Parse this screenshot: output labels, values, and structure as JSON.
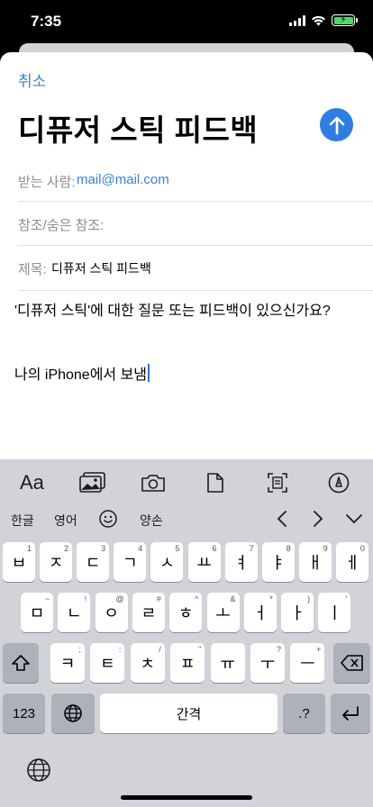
{
  "status": {
    "time": "7:35"
  },
  "compose": {
    "cancel_label": "취소",
    "title": "디퓨저 스틱 피드백",
    "to_label": "받는 사람:",
    "to_value": "mail@mail.com",
    "cc_label": "참조/숨은 참조:",
    "subject_label": "제목:",
    "subject_value": "디퓨저 스틱 피드백",
    "body": "'디퓨저 스틱'에 대한 질문 또는 피드백이 있으신가요?",
    "signature": "나의 iPhone에서 보냄"
  },
  "keyboard": {
    "toolbar": {
      "format_label": "Aa"
    },
    "suggestions": {
      "lang_korean": "한글",
      "lang_english": "영어",
      "suggestion": "양손"
    },
    "row1": [
      {
        "k": "ㅂ",
        "h": "1"
      },
      {
        "k": "ㅈ",
        "h": "2"
      },
      {
        "k": "ㄷ",
        "h": "3"
      },
      {
        "k": "ㄱ",
        "h": "4"
      },
      {
        "k": "ㅅ",
        "h": "5"
      },
      {
        "k": "ㅛ",
        "h": "6"
      },
      {
        "k": "ㅕ",
        "h": "7"
      },
      {
        "k": "ㅑ",
        "h": "8"
      },
      {
        "k": "ㅐ",
        "h": "9"
      },
      {
        "k": "ㅔ",
        "h": "0"
      }
    ],
    "row2": [
      {
        "k": "ㅁ",
        "h": "~"
      },
      {
        "k": "ㄴ",
        "h": "!"
      },
      {
        "k": "ㅇ",
        "h": "@"
      },
      {
        "k": "ㄹ",
        "h": "#"
      },
      {
        "k": "ㅎ",
        "h": "^"
      },
      {
        "k": "ㅗ",
        "h": "&"
      },
      {
        "k": "ㅓ",
        "h": "*"
      },
      {
        "k": "ㅏ",
        "h": ")"
      },
      {
        "k": "ㅣ",
        "h": "'"
      }
    ],
    "row3": [
      {
        "k": "ㅋ",
        "h": ";"
      },
      {
        "k": "ㅌ",
        "h": ":"
      },
      {
        "k": "ㅊ",
        "h": "/"
      },
      {
        "k": "ㅍ",
        "h": "\""
      },
      {
        "k": "ㅠ",
        "h": ""
      },
      {
        "k": "ㅜ",
        "h": "?"
      },
      {
        "k": "ㅡ",
        "h": "+"
      }
    ],
    "numbers_label": "123",
    "space_label": "간격",
    "punct_label": ".?"
  }
}
